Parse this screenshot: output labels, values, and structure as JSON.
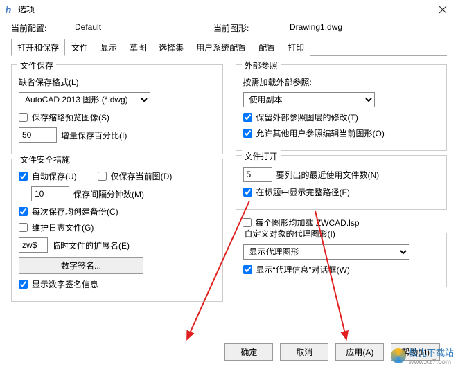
{
  "window": {
    "title": "选项"
  },
  "info": {
    "current_config_label": "当前配置:",
    "current_config_value": "Default",
    "current_drawing_label": "当前图形:",
    "current_drawing_value": "Drawing1.dwg"
  },
  "tabs": [
    "打开和保存",
    "文件",
    "显示",
    "草图",
    "选择集",
    "用户系统配置",
    "配置",
    "打印"
  ],
  "file_save": {
    "legend": "文件保存",
    "default_format_label": "缺省保存格式(L)",
    "format_value": "AutoCAD 2013 图形 (*.dwg)",
    "thumbnail_label": "保存缩略预览图像(S)",
    "incr_value": "50",
    "incr_label": "增量保存百分比(I)"
  },
  "file_safety": {
    "legend": "文件安全措施",
    "autosave_label": "自动保存(U)",
    "only_current_label": "仅保存当前图(D)",
    "interval_value": "10",
    "interval_label": "保存间隔分钟数(M)",
    "backup_label": "每次保存均创建备份(C)",
    "log_label": "维护日志文件(G)",
    "temp_ext_value": "zw$",
    "temp_ext_label": "临时文件的扩展名(E)",
    "signature_button": "数字签名...",
    "show_sig_label": "显示数字签名信息"
  },
  "xref": {
    "legend": "外部参照",
    "load_label": "按需加载外部参照:",
    "load_value": "使用副本",
    "retain_label": "保留外部参照图层的修改(T)",
    "allow_edit_label": "允许其他用户参照编辑当前图形(O)"
  },
  "file_open": {
    "legend": "文件打开",
    "recent_value": "5",
    "recent_label": "要列出的最近使用文件数(N)",
    "fullpath_label": "在标题中显示完整路径(F)"
  },
  "per_drawing_load_label": "每个图形均加载 ZWCAD.lsp",
  "proxy": {
    "legend": "自定义对象的代理图形(I)",
    "value": "显示代理图形",
    "show_info_label": "显示“代理信息”对话框(W)"
  },
  "buttons": {
    "ok": "确定",
    "cancel": "取消",
    "apply": "应用(A)",
    "help": "帮助(H)"
  },
  "watermark": {
    "name": "极光下载站",
    "url": "www.xz7.com"
  }
}
